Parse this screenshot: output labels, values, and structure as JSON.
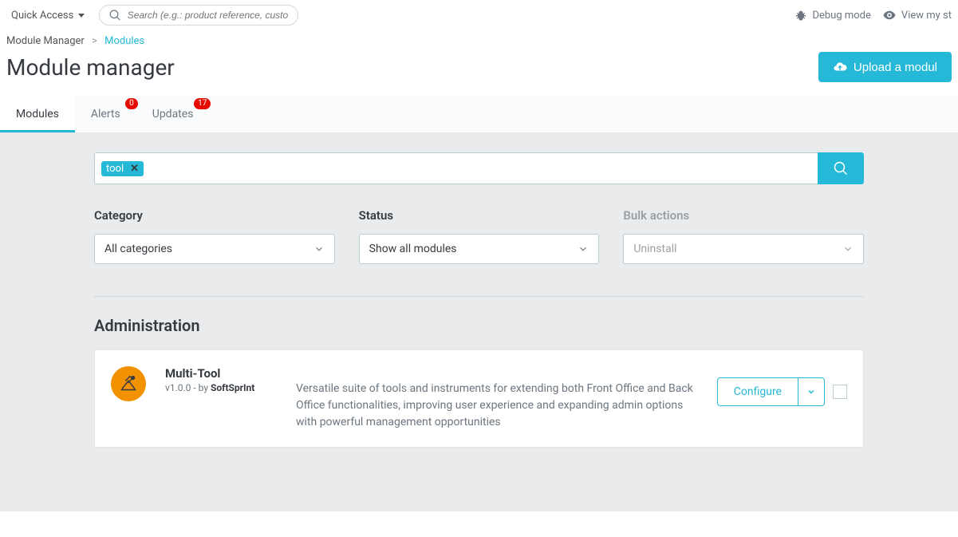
{
  "topbar": {
    "quick_access": "Quick Access",
    "search_placeholder": "Search (e.g.: product reference, custom",
    "debug_mode": "Debug mode",
    "view_shop": "View my st"
  },
  "breadcrumb": {
    "parent": "Module Manager",
    "current": "Modules"
  },
  "page_title": "Module manager",
  "upload_button": "Upload a modul",
  "tabs": {
    "modules": {
      "label": "Modules"
    },
    "alerts": {
      "label": "Alerts",
      "badge": "0"
    },
    "updates": {
      "label": "Updates",
      "badge": "17"
    }
  },
  "search_tag": "tool",
  "filters": {
    "category": {
      "label": "Category",
      "value": "All categories"
    },
    "status": {
      "label": "Status",
      "value": "Show all modules"
    },
    "bulk": {
      "label": "Bulk actions",
      "value": "Uninstall"
    }
  },
  "section_title": "Administration",
  "module": {
    "name": "Multi-Tool",
    "version": "v1.0.0",
    "by": " - by ",
    "author": "SoftSprInt",
    "description": "Versatile suite of tools and instruments for extending both Front Office and Back Office functionalities, improving user experience and expanding admin options with powerful management opportunities",
    "configure": "Configure"
  }
}
